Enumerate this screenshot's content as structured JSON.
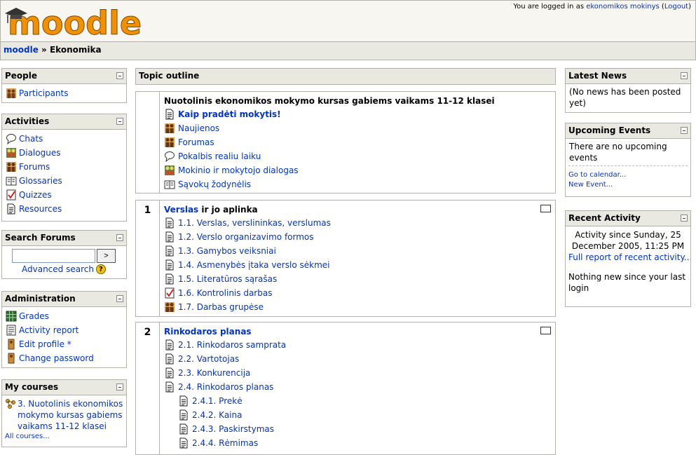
{
  "header": {
    "logo_text": "moodle",
    "login_prefix": "You are logged in as ",
    "user_name": "ekonomikos mokinys",
    "logout_label": "Logout"
  },
  "navbar": {
    "home": "moodle",
    "separator": "»",
    "course": "Ekonomika"
  },
  "people": {
    "title": "People",
    "items": [
      {
        "label": "Participants",
        "icon": "people-icon"
      }
    ]
  },
  "activities": {
    "title": "Activities",
    "items": [
      {
        "label": "Chats",
        "icon": "chat-icon"
      },
      {
        "label": "Dialogues",
        "icon": "dialogue-icon"
      },
      {
        "label": "Forums",
        "icon": "forum-icon"
      },
      {
        "label": "Glossaries",
        "icon": "glossary-icon"
      },
      {
        "label": "Quizzes",
        "icon": "quiz-icon"
      },
      {
        "label": "Resources",
        "icon": "resource-icon"
      }
    ]
  },
  "search_forums": {
    "title": "Search Forums",
    "input_value": "",
    "go_label": ">",
    "advanced_label": "Advanced search"
  },
  "administration": {
    "title": "Administration",
    "items": [
      {
        "label": "Grades",
        "icon": "grades-icon"
      },
      {
        "label": "Activity report",
        "icon": "report-icon"
      },
      {
        "label": "Edit profile *",
        "icon": "edit-profile-icon"
      },
      {
        "label": "Change password",
        "icon": "password-icon"
      }
    ]
  },
  "my_courses": {
    "title": "My courses",
    "course_line1": "3. Nuotolinis ekonomikos",
    "course_line2": "mokymo kursas gabiems",
    "course_line3": "vaikams 11-12 klasei",
    "all_courses": "All courses..."
  },
  "topic_outline": {
    "title": "Topic outline",
    "section0": {
      "title": "Nuotolinis ekonomikos mokymo kursas gabiems vaikams 11-12 klasei",
      "items": [
        {
          "label": "Kaip pradėti mokytis!",
          "icon": "resource-icon",
          "bold": true
        },
        {
          "label": "Naujienos",
          "icon": "forum-icon"
        },
        {
          "label": "Forumas",
          "icon": "forum-icon"
        },
        {
          "label": "Pokalbis realiu laiku",
          "icon": "chat-icon"
        },
        {
          "label": "Mokinio ir mokytojo dialogas",
          "icon": "dialogue-icon"
        },
        {
          "label": "Sąvokų žodynėlis",
          "icon": "glossary-icon"
        }
      ]
    },
    "section1": {
      "number": "1",
      "title_link": "Verslas",
      "title_rest": " ir jo aplinka",
      "items": [
        {
          "label": "1.1. Verslas, verslininkas, verslumas",
          "icon": "resource-icon"
        },
        {
          "label": "1.2. Verslo organizavimo formos",
          "icon": "resource-icon"
        },
        {
          "label": "1.3. Gamybos veiksniai",
          "icon": "resource-icon"
        },
        {
          "label": "1.4. Asmenybės įtaka verslo sėkmei",
          "icon": "resource-icon"
        },
        {
          "label": "1.5. Literatūros sąrašas",
          "icon": "resource-icon"
        },
        {
          "label": "1.6. Kontrolinis darbas",
          "icon": "quiz-icon"
        },
        {
          "label": "1.7. Darbas grupėse",
          "icon": "forum-icon"
        }
      ]
    },
    "section2": {
      "number": "2",
      "title_link": "Rinkodaros planas",
      "items": [
        {
          "label": "2.1. Rinkodaros samprata",
          "icon": "resource-icon"
        },
        {
          "label": "2.2. Vartotojas",
          "icon": "resource-icon"
        },
        {
          "label": "2.3. Konkurencija",
          "icon": "resource-icon"
        },
        {
          "label": "2.4. Rinkodaros planas",
          "icon": "resource-icon"
        },
        {
          "label": "2.4.1. Prekė",
          "icon": "resource-icon",
          "indent": true
        },
        {
          "label": "2.4.2. Kaina",
          "icon": "resource-icon",
          "indent": true
        },
        {
          "label": "2.4.3. Paskirstymas",
          "icon": "resource-icon",
          "indent": true
        },
        {
          "label": "2.4.4. Rėmimas",
          "icon": "resource-icon",
          "indent": true
        }
      ]
    }
  },
  "latest_news": {
    "title": "Latest News",
    "text": "(No news has been posted yet)"
  },
  "upcoming_events": {
    "title": "Upcoming Events",
    "text": "There are no upcoming events",
    "calendar_link": "Go to calendar...",
    "new_event_link": "New Event..."
  },
  "recent_activity": {
    "title": "Recent Activity",
    "since_text": "Activity since Sunday, 25 December 2005, 11:25 PM",
    "full_report": "Full report of recent activity...",
    "nothing_text": "Nothing new since your last login"
  },
  "colors": {
    "header_bg": "#f7f6f1",
    "block_head_bg": "#eae9e1",
    "border": "#b3b2aa",
    "link": "#0033cc",
    "logo_orange": "#f29000"
  }
}
